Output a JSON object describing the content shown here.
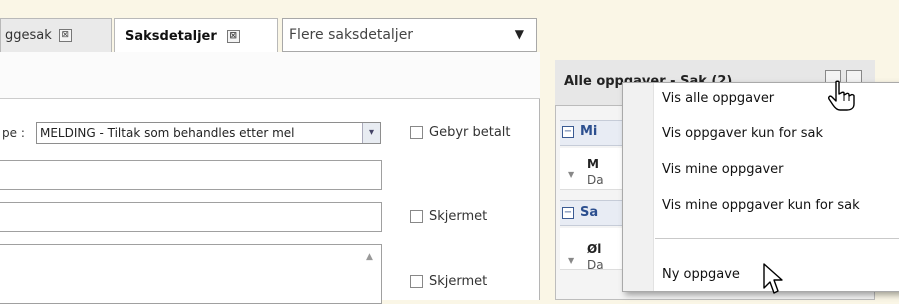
{
  "tabs": [
    {
      "label": "ggesak",
      "active": false
    },
    {
      "label": "Saksdetaljer",
      "active": true
    }
  ],
  "tab_close_glyph": "⊠",
  "more_details_dropdown": {
    "value": "Flere saksdetaljer",
    "arrow": "▼"
  },
  "form": {
    "type_label": "pe :",
    "type_value": "MELDING - Tiltak som behandles etter mel",
    "select_arrow": "▾",
    "checkboxes": [
      "Gebyr betalt",
      "Skjermet",
      "Skjermet"
    ],
    "scroll_arrow": "▲"
  },
  "tasks_panel": {
    "title": "Alle oppgaver - Sak (2)",
    "groups": [
      {
        "label": "Mi",
        "tasks": [
          {
            "title": "M",
            "sub": "Da"
          }
        ]
      },
      {
        "label": "Sa",
        "tasks": [
          {
            "title": "Øl",
            "sub": "Da"
          }
        ]
      }
    ],
    "group_toggle": "−",
    "expand_glyph": "▼"
  },
  "context_menu": {
    "items": [
      "Vis alle oppgaver",
      "Vis oppgaver kun for sak",
      "Vis mine oppgaver",
      "Vis mine oppgaver kun for sak",
      "Ny oppgave"
    ]
  },
  "icons": {
    "hand": "hand-pointer-icon",
    "arrow": "arrow-cursor-icon"
  }
}
